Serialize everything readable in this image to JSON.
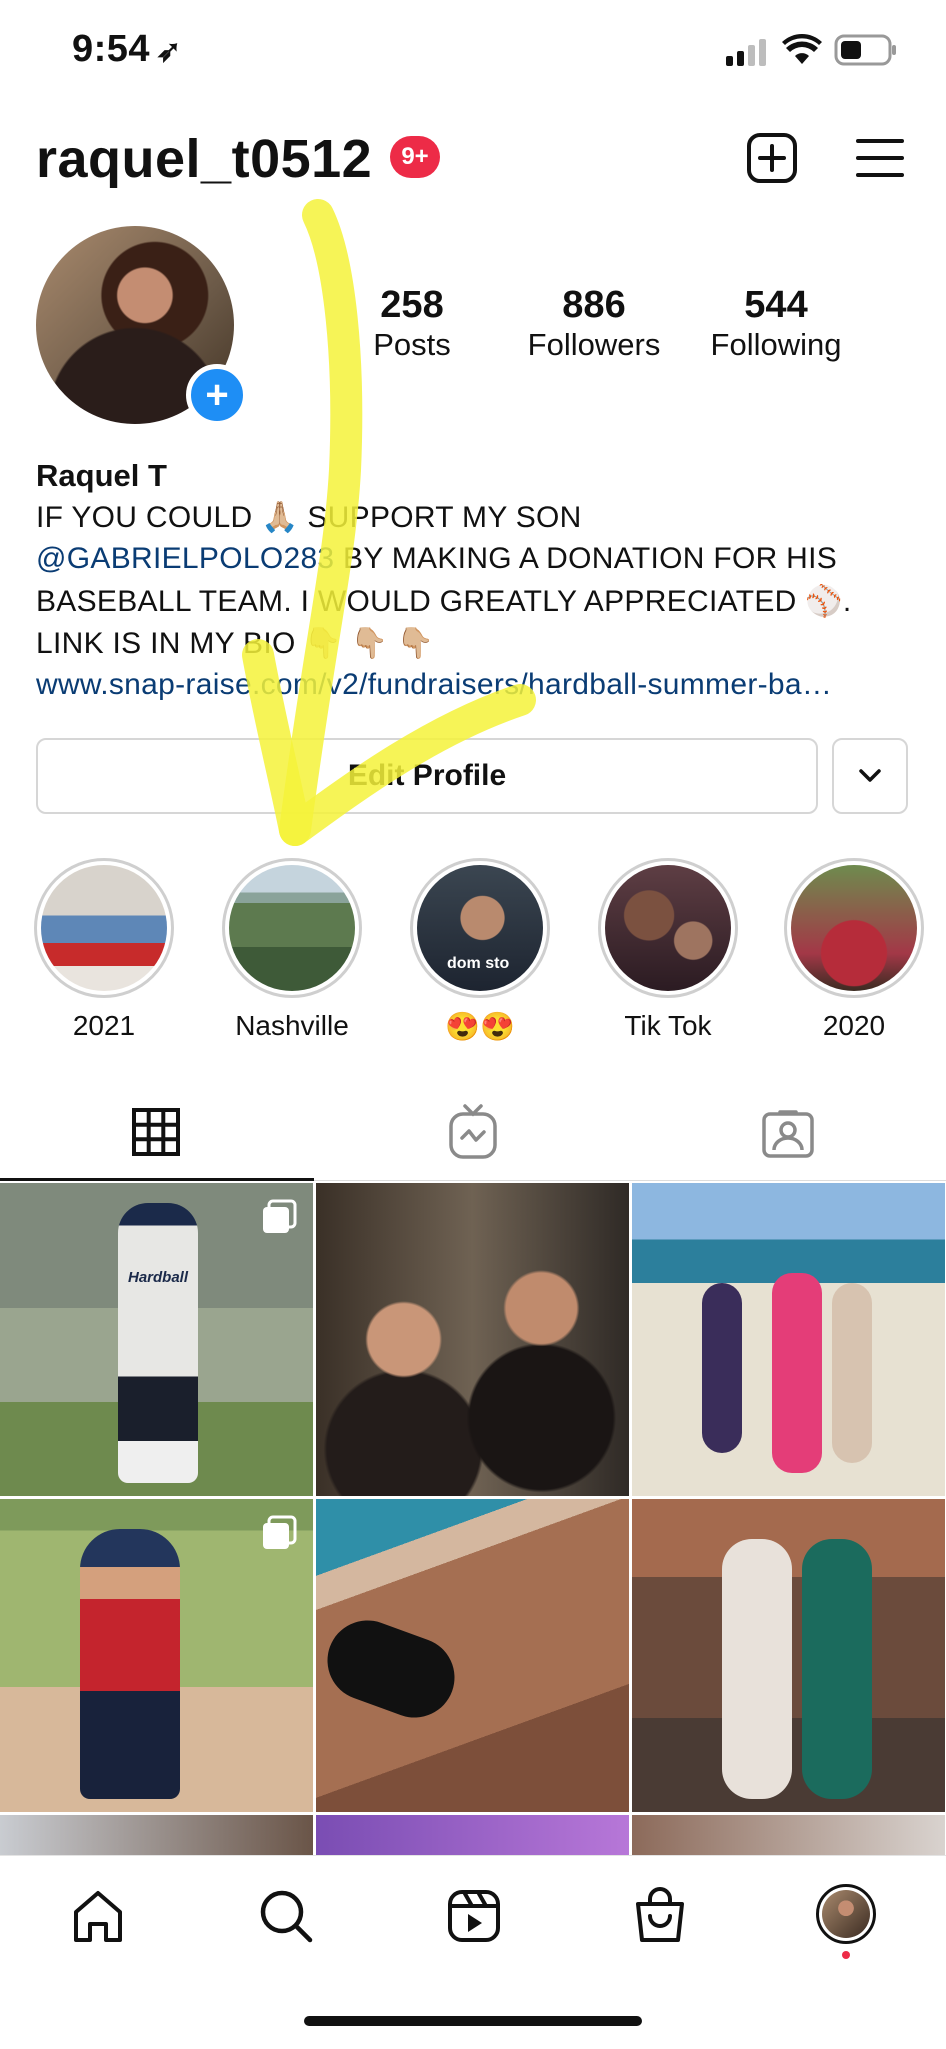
{
  "status_bar": {
    "time": "9:54"
  },
  "header": {
    "username": "raquel_t0512",
    "notification_badge": "9+"
  },
  "stats": [
    {
      "value": "258",
      "label": "Posts"
    },
    {
      "value": "886",
      "label": "Followers"
    },
    {
      "value": "544",
      "label": "Following"
    }
  ],
  "bio": {
    "name": "Raquel T",
    "line1_a": "IF YOU COULD ",
    "line1_emoji": "🙏🏼",
    "line1_b": " SUPPORT MY SON",
    "line2_mention": "@GABRIELPOLO283",
    "line2_rest": " BY MAKING A DONATION FOR HIS",
    "line3": "BASEBALL TEAM. I WOULD GREATLY APPRECIATED ⚾.",
    "line4": "LINK IS IN MY BIO  👇🏼 👇🏼 👇🏼",
    "link": "www.snap-raise.com/v2/fundraisers/hardball-summer-ba…"
  },
  "profile_actions": {
    "edit_label": "Edit Profile"
  },
  "highlights": [
    {
      "label": "2021"
    },
    {
      "label": "Nashville"
    },
    {
      "label": "😍😍",
      "overlay_text": "dom sto"
    },
    {
      "label": "Tik Tok"
    },
    {
      "label": "2020"
    }
  ],
  "tabs": [
    {
      "icon": "grid-icon",
      "active": true
    },
    {
      "icon": "igtv-icon",
      "active": false
    },
    {
      "icon": "tagged-icon",
      "active": false
    }
  ],
  "posts": [
    {
      "subject": "baseball-player",
      "jersey_text": "Hardball",
      "multi": true
    },
    {
      "subject": "selfie-night",
      "multi": false
    },
    {
      "subject": "beach-group",
      "multi": false
    },
    {
      "subject": "kid-baseball",
      "multi": true
    },
    {
      "subject": "pool-selfie",
      "multi": false
    },
    {
      "subject": "restaurant-pair",
      "multi": false
    }
  ],
  "bottom_nav": [
    {
      "icon": "home-icon"
    },
    {
      "icon": "search-icon"
    },
    {
      "icon": "reels-icon"
    },
    {
      "icon": "shop-icon"
    },
    {
      "icon": "profile-avatar"
    }
  ],
  "colors": {
    "badge": "#ed2b47",
    "link": "#0a3c74",
    "add_button": "#1e8ef5",
    "annotation": "#f4f23a"
  }
}
